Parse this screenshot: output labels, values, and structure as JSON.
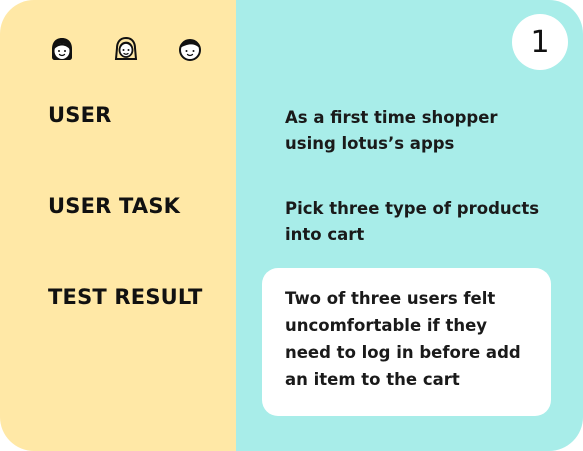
{
  "card": {
    "step_number": "1",
    "rows": [
      {
        "label": "USER",
        "value": "As a first time shopper using lotus’s apps"
      },
      {
        "label": "USER TASK",
        "value": "Pick three type of products into cart"
      },
      {
        "label": "TEST RESULT",
        "value": "Two of three users felt uncomfortable if they need to log in before add an item to the cart"
      }
    ],
    "avatars": [
      {
        "icon": "woman-face-icon"
      },
      {
        "icon": "woman-long-hair-face-icon"
      },
      {
        "icon": "man-face-icon"
      }
    ]
  },
  "colors": {
    "left_panel": "#ffe8a6",
    "right_panel": "#a8ede9",
    "highlight_box": "#ffffff",
    "text": "#111111"
  }
}
